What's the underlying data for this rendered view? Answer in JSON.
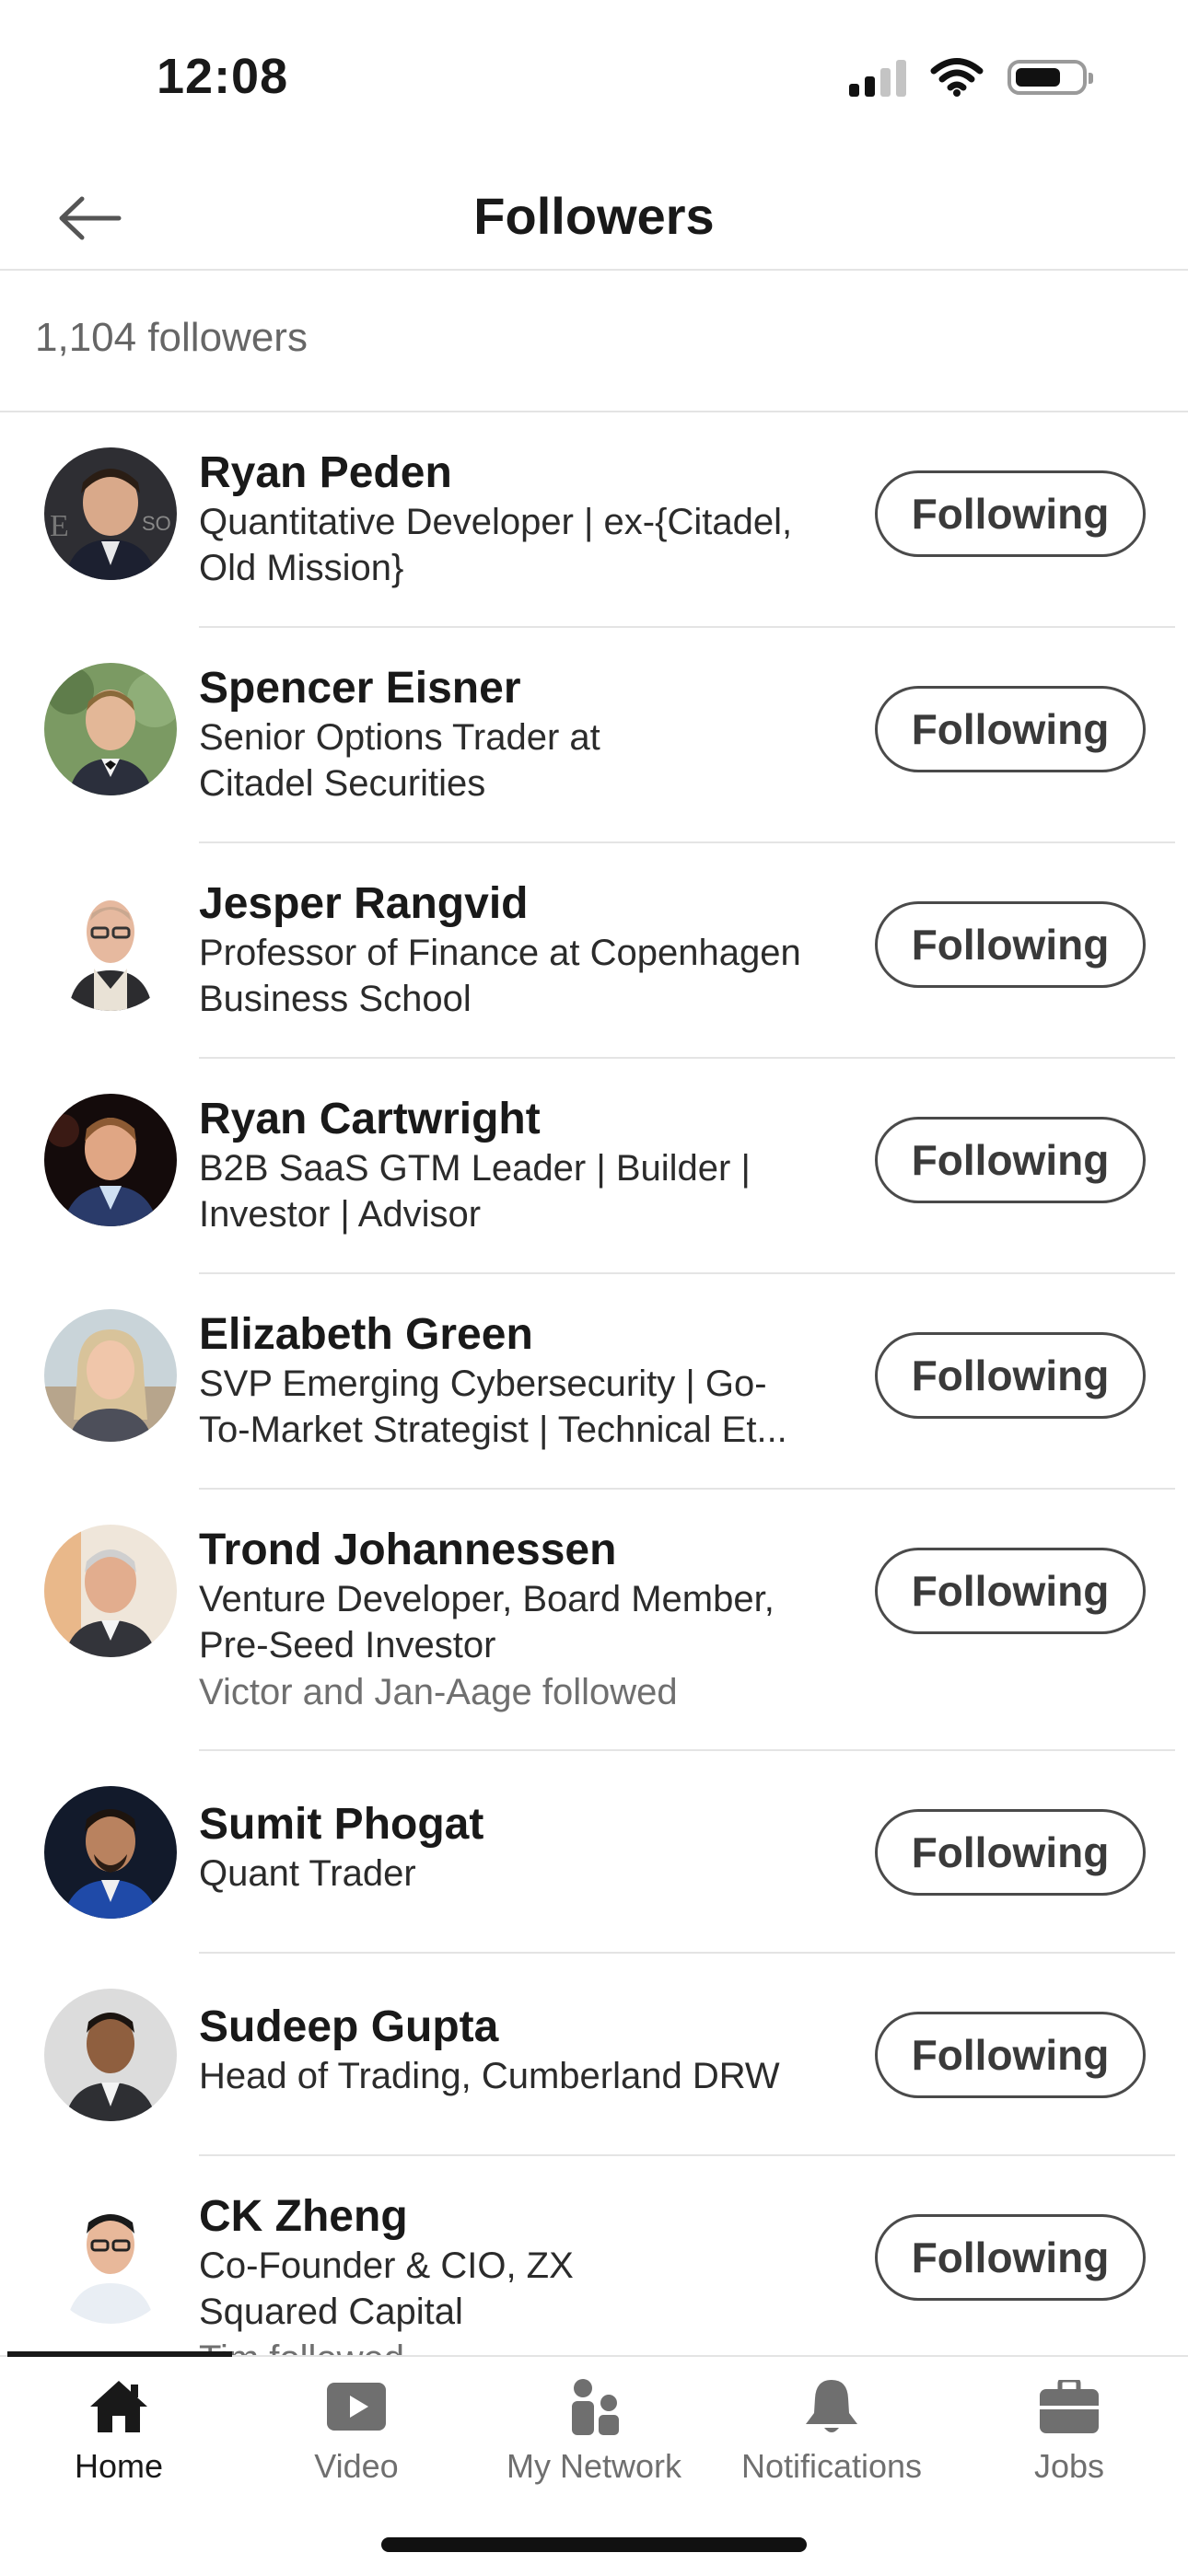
{
  "status_bar": {
    "time": "12:08",
    "signal_icon": "cellular-signal-icon",
    "wifi_icon": "wifi-icon",
    "battery_icon": "battery-icon"
  },
  "header": {
    "title": "Followers",
    "back_icon": "back-arrow-icon"
  },
  "summary": {
    "count_label": "1,104 followers"
  },
  "follow_button_label": "Following",
  "followers": [
    {
      "name": "Ryan Peden",
      "headline_lines": [
        "Quantitative Developer | ex-{Citadel,",
        "Old Mission}"
      ],
      "mutual": ""
    },
    {
      "name": "Spencer Eisner",
      "headline_lines": [
        "Senior Options Trader at",
        "Citadel Securities"
      ],
      "mutual": ""
    },
    {
      "name": "Jesper Rangvid",
      "headline_lines": [
        "Professor of Finance at Copenhagen",
        "Business School"
      ],
      "mutual": ""
    },
    {
      "name": "Ryan Cartwright",
      "headline_lines": [
        "B2B SaaS GTM Leader | Builder |",
        "Investor | Advisor"
      ],
      "mutual": ""
    },
    {
      "name": "Elizabeth Green",
      "headline_lines": [
        "SVP Emerging Cybersecurity | Go-",
        "To-Market Strategist | Technical Et..."
      ],
      "mutual": ""
    },
    {
      "name": "Trond Johannessen",
      "headline_lines": [
        "Venture Developer, Board Member,",
        "Pre-Seed Investor"
      ],
      "mutual": "Victor and Jan-Aage followed"
    },
    {
      "name": "Sumit Phogat",
      "headline_lines": [
        "Quant Trader"
      ],
      "mutual": ""
    },
    {
      "name": "Sudeep Gupta",
      "headline_lines": [
        "Head of Trading, Cumberland DRW"
      ],
      "mutual": ""
    },
    {
      "name": "CK Zheng",
      "headline_lines": [
        "Co-Founder & CIO, ZX",
        "Squared Capital"
      ],
      "mutual": "Tim followed"
    }
  ],
  "tabbar": {
    "active": "Home",
    "items": [
      {
        "label": "Home",
        "icon": "home-icon"
      },
      {
        "label": "Video",
        "icon": "video-icon"
      },
      {
        "label": "My Network",
        "icon": "my-network-icon"
      },
      {
        "label": "Notifications",
        "icon": "notifications-bell-icon"
      },
      {
        "label": "Jobs",
        "icon": "jobs-briefcase-icon"
      }
    ]
  },
  "colors": {
    "text": "#191919",
    "muted": "#6f6f6f",
    "divider": "#e4e4e4",
    "button_border": "#4a4a4a"
  }
}
